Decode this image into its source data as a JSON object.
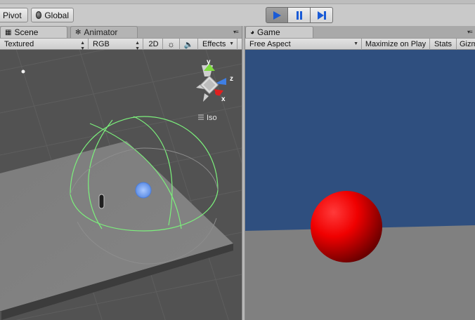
{
  "toolbar": {
    "pivot_label": "Pivot",
    "global_label": "Global",
    "play_icon": "play-icon",
    "pause_icon": "pause-icon",
    "step_icon": "step-icon"
  },
  "scene": {
    "tabs": [
      {
        "label": "Scene",
        "icon": "grid-icon",
        "active": true
      },
      {
        "label": "Animator",
        "icon": "animator-icon",
        "active": false
      }
    ],
    "controls": {
      "shading": "Textured",
      "render_mode": "RGB",
      "mode_2d": "2D",
      "lighting_icon": "sun-icon",
      "audio_icon": "speaker-icon",
      "effects": "Effects"
    },
    "gizmo": {
      "y_label": "y",
      "z_label": "z",
      "x_label": "x",
      "projection": "Iso"
    }
  },
  "game": {
    "tab": {
      "label": "Game",
      "icon": "pacman-icon"
    },
    "controls": {
      "aspect": "Free Aspect",
      "maximize": "Maximize on Play",
      "stats": "Stats",
      "gizmos": "Gizm"
    }
  },
  "colors": {
    "sky": "#2f4f7f",
    "ground": "#808080",
    "sphere": "#ff0000",
    "scene_bg": "#525252",
    "light_gizmo": "#7cf07c",
    "play_active": "#1a5bd6"
  }
}
